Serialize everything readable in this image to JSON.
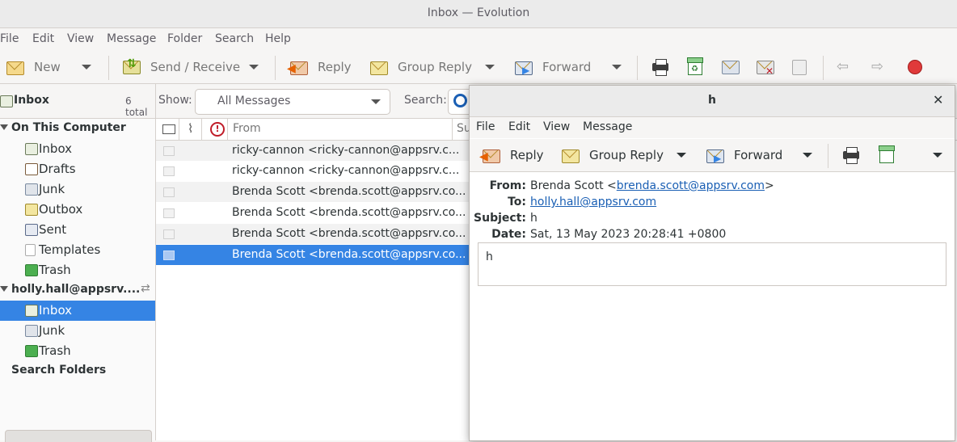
{
  "window": {
    "title": "Inbox — Evolution"
  },
  "menu": [
    "File",
    "Edit",
    "View",
    "Message",
    "Folder",
    "Search",
    "Help"
  ],
  "toolbar": {
    "new": "New",
    "send_receive": "Send / Receive",
    "reply": "Reply",
    "group_reply": "Group Reply",
    "forward": "Forward"
  },
  "sidebar": {
    "header": "Inbox",
    "total": "6 total",
    "local_group": "On This Computer",
    "local_items": [
      "Inbox",
      "Drafts",
      "Junk",
      "Outbox",
      "Sent",
      "Templates",
      "Trash"
    ],
    "account": "holly.hall@appsrv....",
    "account_items": [
      "Inbox",
      "Junk",
      "Trash"
    ],
    "search_folders": "Search Folders"
  },
  "filter": {
    "show_label": "Show:",
    "show_value": "All Messages",
    "search_label": "Search:"
  },
  "columns": {
    "from": "From",
    "subject": "Su"
  },
  "messages": [
    {
      "from": "ricky-cannon <ricky-cannon@appsrv.c..."
    },
    {
      "from": "ricky-cannon <ricky-cannon@appsrv.c..."
    },
    {
      "from": "Brenda Scott <brenda.scott@appsrv.co..."
    },
    {
      "from": "Brenda Scott <brenda.scott@appsrv.co..."
    },
    {
      "from": "Brenda Scott <brenda.scott@appsrv.co..."
    },
    {
      "from": "Brenda Scott <brenda.scott@appsrv.co..."
    }
  ],
  "popup": {
    "title": "h",
    "menu": [
      "File",
      "Edit",
      "View",
      "Message"
    ],
    "reply": "Reply",
    "group_reply": "Group Reply",
    "forward": "Forward",
    "from_label": "From:",
    "from_name": "Brenda Scott <",
    "from_email": "brenda.scott@appsrv.com",
    "from_close": ">",
    "to_label": "To:",
    "to_email": "holly.hall@appsrv.com",
    "subject_label": "Subject:",
    "subject": "h",
    "date_label": "Date:",
    "date": "Sat, 13 May 2023 20:28:41 +0800",
    "body": "h"
  },
  "colors": {
    "accent": "#3584e4",
    "link": "#1a5fb4"
  }
}
